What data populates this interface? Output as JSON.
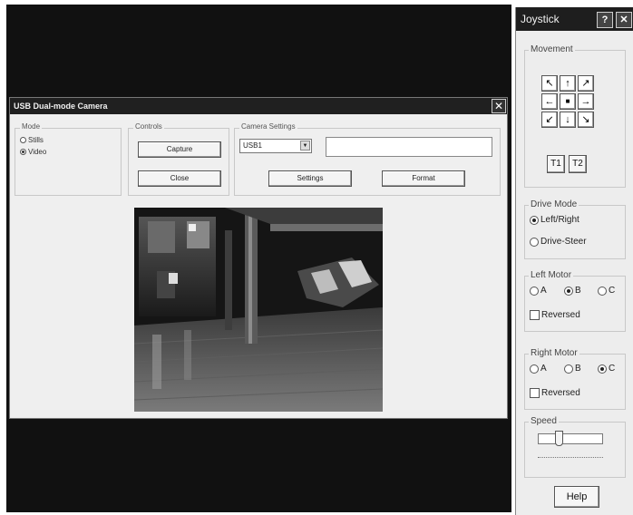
{
  "camera_window": {
    "title": "USB Dual-mode Camera",
    "close_glyph": "✕",
    "mode": {
      "label": "Mode",
      "options": [
        "Stills",
        "Video"
      ],
      "selected": "Video"
    },
    "controls": {
      "label": "Controls",
      "capture": "Capture",
      "close": "Close"
    },
    "camera_settings": {
      "label": "Camera Settings",
      "device_selected": "USB1",
      "text_value": "",
      "settings_button": "Settings",
      "format_button": "Format"
    }
  },
  "joystick": {
    "title": "Joystick",
    "help_glyph": "?",
    "close_glyph": "✕",
    "movement": {
      "label": "Movement",
      "arrows": [
        "↖",
        "↑",
        "↗",
        "←",
        "■",
        "→",
        "↙",
        "↓",
        "↘"
      ],
      "t1": "T1",
      "t2": "T2"
    },
    "drive_mode": {
      "label": "Drive Mode",
      "options": [
        "Left/Right",
        "Drive-Steer"
      ],
      "selected": "Left/Right"
    },
    "left_motor": {
      "label": "Left Motor",
      "options": [
        "A",
        "B",
        "C"
      ],
      "selected": "B",
      "reversed_label": "Reversed",
      "reversed": false
    },
    "right_motor": {
      "label": "Right Motor",
      "options": [
        "A",
        "B",
        "C"
      ],
      "selected": "C",
      "reversed_label": "Reversed",
      "reversed": false
    },
    "speed": {
      "label": "Speed",
      "value_fraction": 0.3
    },
    "help_button": "Help"
  }
}
